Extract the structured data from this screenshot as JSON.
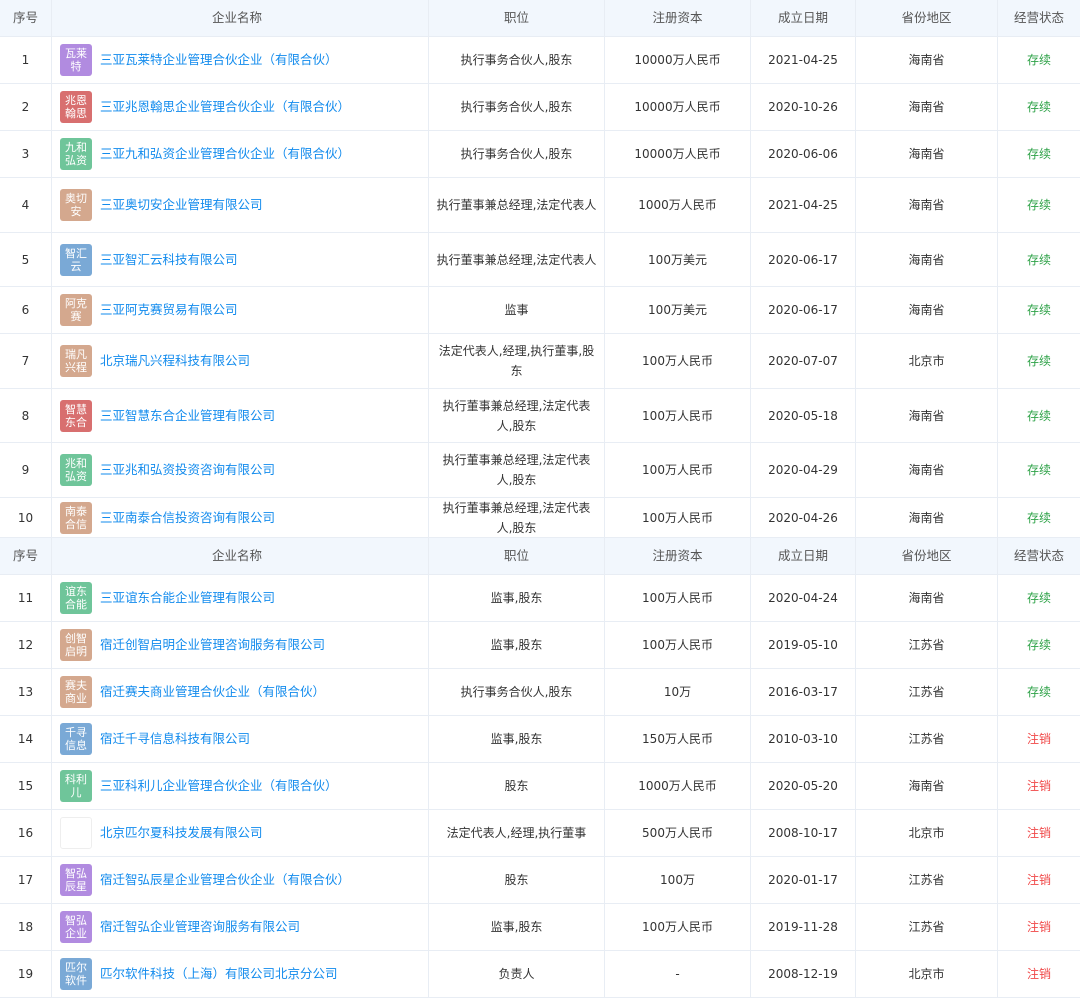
{
  "headers": {
    "seq": "序号",
    "name": "企业名称",
    "position": "职位",
    "capital": "注册资本",
    "date": "成立日期",
    "province": "省份地区",
    "status": "经营状态"
  },
  "colors": {
    "link": "#128bed",
    "status_active": "#2ea248",
    "status_cancelled": "#f04848",
    "header_bg": "#f2f7fd"
  },
  "page1": [
    {
      "seq": "1",
      "logo": "瓦莱特",
      "logo_color": "#b18be0",
      "name": "三亚瓦莱特企业管理合伙企业（有限合伙）",
      "position": "执行事务合伙人,股东",
      "capital": "10000万人民币",
      "date": "2021-04-25",
      "province": "海南省",
      "status": "存续",
      "status_type": "active"
    },
    {
      "seq": "2",
      "logo": "兆恩翰思",
      "logo_color": "#d86f6f",
      "name": "三亚兆恩翰思企业管理合伙企业（有限合伙）",
      "position": "执行事务合伙人,股东",
      "capital": "10000万人民币",
      "date": "2020-10-26",
      "province": "海南省",
      "status": "存续",
      "status_type": "active"
    },
    {
      "seq": "3",
      "logo": "九和弘资",
      "logo_color": "#6fc59a",
      "name": "三亚九和弘资企业管理合伙企业（有限合伙）",
      "position": "执行事务合伙人,股东",
      "capital": "10000万人民币",
      "date": "2020-06-06",
      "province": "海南省",
      "status": "存续",
      "status_type": "active"
    },
    {
      "seq": "4",
      "logo": "奥切安",
      "logo_color": "#d4a88e",
      "name": "三亚奥切安企业管理有限公司",
      "position": "执行董事兼总经理,法定代表人",
      "capital": "1000万人民币",
      "date": "2021-04-25",
      "province": "海南省",
      "status": "存续",
      "status_type": "active"
    },
    {
      "seq": "5",
      "logo": "智汇云",
      "logo_color": "#7aa9d6",
      "name": "三亚智汇云科技有限公司",
      "position": "执行董事兼总经理,法定代表人",
      "capital": "100万美元",
      "date": "2020-06-17",
      "province": "海南省",
      "status": "存续",
      "status_type": "active"
    },
    {
      "seq": "6",
      "logo": "阿克赛",
      "logo_color": "#d4a88e",
      "name": "三亚阿克赛贸易有限公司",
      "position": "监事",
      "capital": "100万美元",
      "date": "2020-06-17",
      "province": "海南省",
      "status": "存续",
      "status_type": "active"
    },
    {
      "seq": "7",
      "logo": "瑞凡兴程",
      "logo_color": "#d4a88e",
      "name": "北京瑞凡兴程科技有限公司",
      "position": "法定代表人,经理,执行董事,股东",
      "capital": "100万人民币",
      "date": "2020-07-07",
      "province": "北京市",
      "status": "存续",
      "status_type": "active"
    },
    {
      "seq": "8",
      "logo": "智慧东合",
      "logo_color": "#d86f6f",
      "name": "三亚智慧东合企业管理有限公司",
      "position": "执行董事兼总经理,法定代表人,股东",
      "capital": "100万人民币",
      "date": "2020-05-18",
      "province": "海南省",
      "status": "存续",
      "status_type": "active"
    },
    {
      "seq": "9",
      "logo": "兆和弘资",
      "logo_color": "#6fc59a",
      "name": "三亚兆和弘资投资咨询有限公司",
      "position": "执行董事兼总经理,法定代表人,股东",
      "capital": "100万人民币",
      "date": "2020-04-29",
      "province": "海南省",
      "status": "存续",
      "status_type": "active"
    },
    {
      "seq": "10",
      "logo": "南泰合信",
      "logo_color": "#d4a88e",
      "name": "三亚南泰合信投资咨询有限公司",
      "position": "执行董事兼总经理,法定代表人,股东",
      "capital": "100万人民币",
      "date": "2020-04-26",
      "province": "海南省",
      "status": "存续",
      "status_type": "active"
    }
  ],
  "page2": [
    {
      "seq": "11",
      "logo": "谊东合能",
      "logo_color": "#6fc59a",
      "name": "三亚谊东合能企业管理有限公司",
      "position": "监事,股东",
      "capital": "100万人民币",
      "date": "2020-04-24",
      "province": "海南省",
      "status": "存续",
      "status_type": "active"
    },
    {
      "seq": "12",
      "logo": "创智启明",
      "logo_color": "#d4a88e",
      "name": "宿迁创智启明企业管理咨询服务有限公司",
      "position": "监事,股东",
      "capital": "100万人民币",
      "date": "2019-05-10",
      "province": "江苏省",
      "status": "存续",
      "status_type": "active"
    },
    {
      "seq": "13",
      "logo": "赛夫商业",
      "logo_color": "#d4a88e",
      "name": "宿迁赛夫商业管理合伙企业（有限合伙）",
      "position": "执行事务合伙人,股东",
      "capital": "10万",
      "date": "2016-03-17",
      "province": "江苏省",
      "status": "存续",
      "status_type": "active"
    },
    {
      "seq": "14",
      "logo": "千寻信息",
      "logo_color": "#7aa9d6",
      "name": "宿迁千寻信息科技有限公司",
      "position": "监事,股东",
      "capital": "150万人民币",
      "date": "2010-03-10",
      "province": "江苏省",
      "status": "注销",
      "status_type": "cancelled"
    },
    {
      "seq": "15",
      "logo": "科利儿",
      "logo_color": "#6fc59a",
      "name": "三亚科利儿企业管理合伙企业（有限合伙）",
      "position": "股东",
      "capital": "1000万人民币",
      "date": "2020-05-20",
      "province": "海南省",
      "status": "注销",
      "status_type": "cancelled"
    },
    {
      "seq": "16",
      "logo": "",
      "logo_color": "#ffffff",
      "logo_image": true,
      "name": "北京匹尔夏科技发展有限公司",
      "position": "法定代表人,经理,执行董事",
      "capital": "500万人民币",
      "date": "2008-10-17",
      "province": "北京市",
      "status": "注销",
      "status_type": "cancelled"
    },
    {
      "seq": "17",
      "logo": "智弘辰星",
      "logo_color": "#b18be0",
      "name": "宿迁智弘辰星企业管理合伙企业（有限合伙）",
      "position": "股东",
      "capital": "100万",
      "date": "2020-01-17",
      "province": "江苏省",
      "status": "注销",
      "status_type": "cancelled"
    },
    {
      "seq": "18",
      "logo": "智弘企业",
      "logo_color": "#b18be0",
      "name": "宿迁智弘企业管理咨询服务有限公司",
      "position": "监事,股东",
      "capital": "100万人民币",
      "date": "2019-11-28",
      "province": "江苏省",
      "status": "注销",
      "status_type": "cancelled"
    },
    {
      "seq": "19",
      "logo": "匹尔软件",
      "logo_color": "#7aa9d6",
      "name": "匹尔软件科技（上海）有限公司北京分公司",
      "position": "负责人",
      "capital": "-",
      "date": "2008-12-19",
      "province": "北京市",
      "status": "注销",
      "status_type": "cancelled"
    }
  ]
}
